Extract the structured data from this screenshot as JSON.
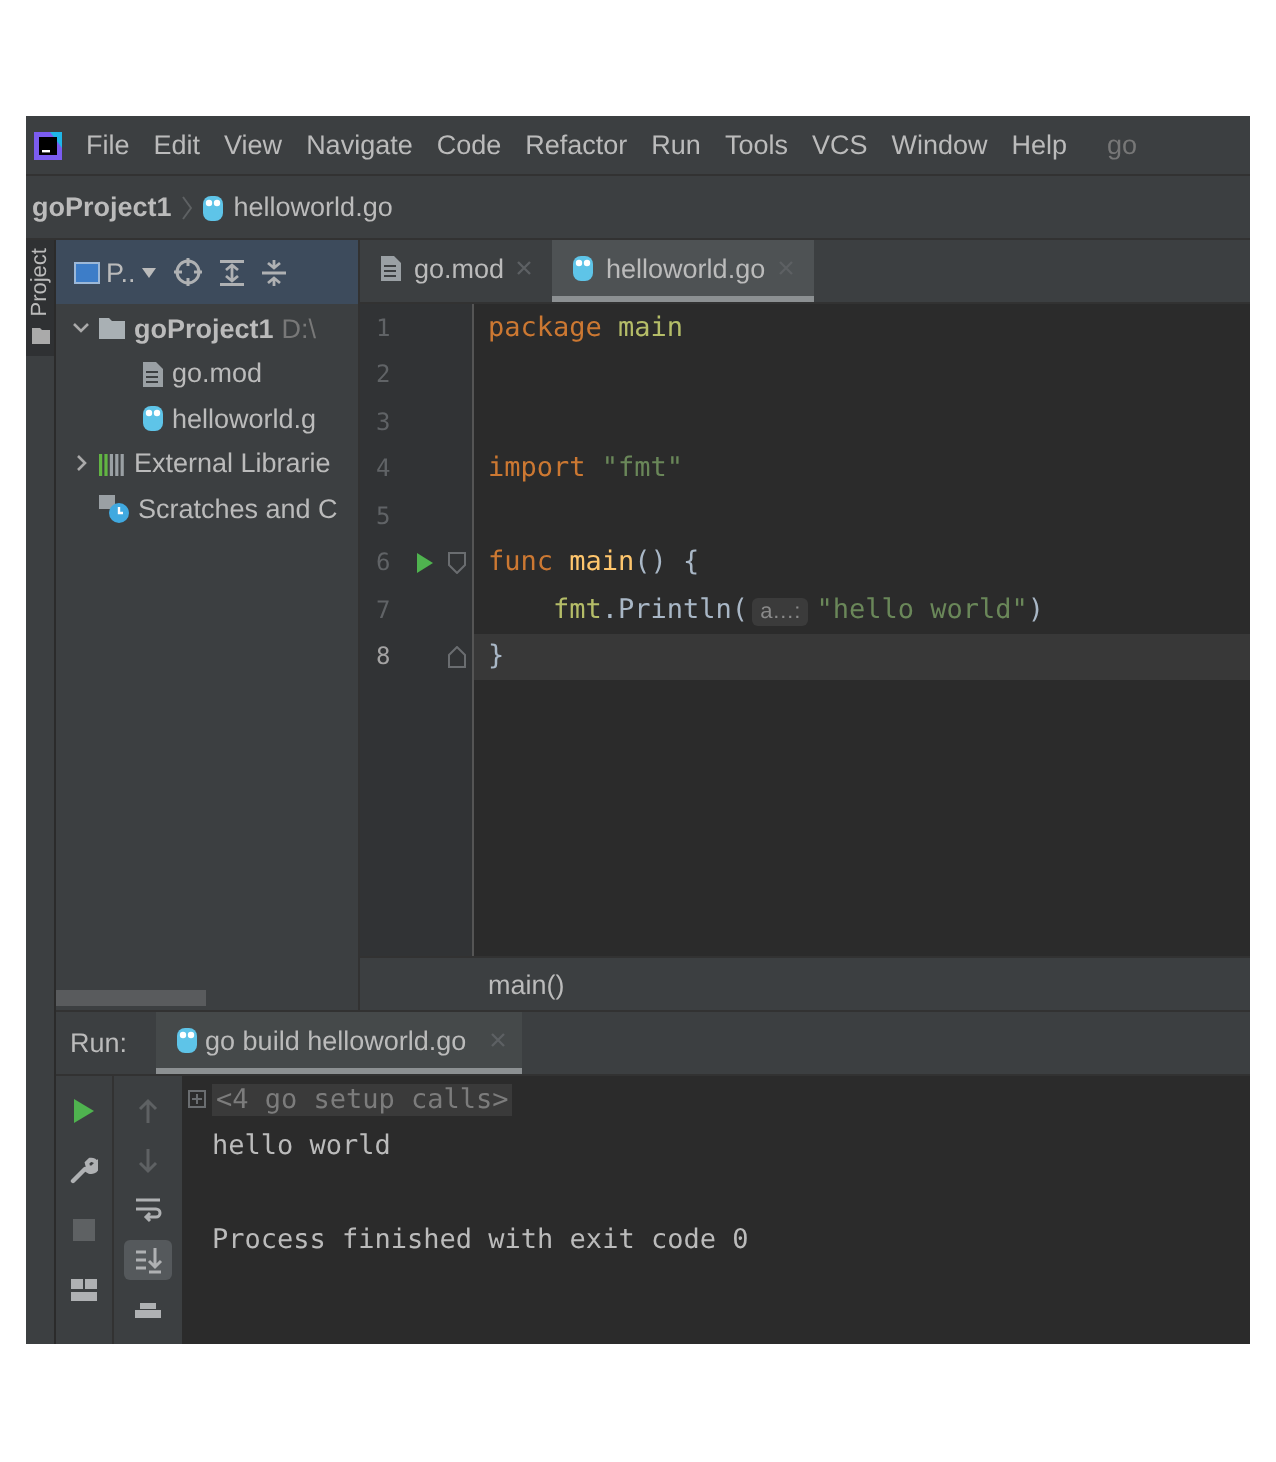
{
  "menu_bar": {
    "items": [
      {
        "label": "File"
      },
      {
        "label": "Edit"
      },
      {
        "label": "View"
      },
      {
        "label": "Navigate"
      },
      {
        "label": "Code"
      },
      {
        "label": "Refactor"
      },
      {
        "label": "Run"
      },
      {
        "label": "Tools"
      },
      {
        "label": "VCS"
      },
      {
        "label": "Window"
      },
      {
        "label": "Help"
      }
    ],
    "project_name": "go"
  },
  "breadcrumb": [
    {
      "label": "goProject1",
      "kind": "project"
    },
    {
      "label": "helloworld.go",
      "kind": "gofile"
    }
  ],
  "tool_stripe": {
    "label": "Project"
  },
  "project_panel": {
    "view_selector": "P..",
    "tree": [
      {
        "label": "goProject1",
        "path": "D:\\",
        "kind": "project",
        "expanded": true,
        "children": [
          {
            "label": "go.mod",
            "kind": "modfile"
          },
          {
            "label": "helloworld.g",
            "kind": "gofile"
          }
        ]
      },
      {
        "label": "External Librarie",
        "kind": "library",
        "expanded": false
      },
      {
        "label": "Scratches and C",
        "kind": "scratch"
      }
    ]
  },
  "editor_tabs": [
    {
      "label": "go.mod",
      "kind": "modfile",
      "selected": false
    },
    {
      "label": "helloworld.go",
      "kind": "gofile",
      "selected": true
    }
  ],
  "code_lines": [
    {
      "number": "1",
      "current": false,
      "runnable": false,
      "fold_start": false,
      "fold_end": false,
      "tokens": [
        {
          "text": "package ",
          "kind": "keyword"
        },
        {
          "text": "main",
          "kind": "package"
        }
      ]
    },
    {
      "number": "2",
      "current": false,
      "runnable": false,
      "fold_start": false,
      "fold_end": false
    },
    {
      "number": "3",
      "current": false,
      "runnable": false,
      "fold_start": false,
      "fold_end": false
    },
    {
      "number": "4",
      "current": false,
      "runnable": false,
      "fold_start": false,
      "fold_end": false,
      "tokens": [
        {
          "text": "import ",
          "kind": "keyword"
        },
        {
          "text": "\"fmt\"",
          "kind": "string"
        }
      ]
    },
    {
      "number": "5",
      "current": false,
      "runnable": false,
      "fold_start": false,
      "fold_end": false
    },
    {
      "number": "6",
      "current": false,
      "runnable": true,
      "fold_start": true,
      "fold_end": false,
      "tokens": [
        {
          "text": "func ",
          "kind": "keyword"
        },
        {
          "text": "main",
          "kind": "function"
        },
        {
          "text": "() {",
          "kind": "plain"
        }
      ]
    },
    {
      "number": "7",
      "current": false,
      "runnable": false,
      "fold_start": false,
      "fold_end": false,
      "tokens": [
        {
          "text": "    fmt",
          "kind": "package"
        },
        {
          "text": ".Println(",
          "kind": "plain"
        },
        {
          "text": "a…:",
          "kind": "hint"
        },
        {
          "text": "\"hello world\"",
          "kind": "string"
        },
        {
          "text": ")",
          "kind": "plain"
        }
      ]
    },
    {
      "number": "8",
      "current": true,
      "runnable": false,
      "fold_start": false,
      "fold_end": true,
      "tokens": [
        {
          "text": "}",
          "kind": "plain"
        }
      ]
    }
  ],
  "editor_breadcrumb": "main()",
  "run_panel": {
    "label": "Run:",
    "tabs": [
      {
        "label": "go build helloworld.go",
        "selected": true
      }
    ],
    "toolbar_left": [
      {
        "kind": "run",
        "disabled": false
      },
      {
        "kind": "wrench",
        "disabled": false
      },
      {
        "kind": "stop",
        "disabled": true
      },
      {
        "kind": "layout",
        "disabled": false
      }
    ],
    "toolbar_right": [
      {
        "kind": "up",
        "disabled": true
      },
      {
        "kind": "down",
        "disabled": true
      },
      {
        "kind": "wrap",
        "disabled": false,
        "on": false
      },
      {
        "kind": "scroll-end",
        "disabled": false,
        "on": true
      },
      {
        "kind": "print",
        "disabled": false
      }
    ],
    "console": [
      {
        "kind": "fold",
        "text": "<4 go setup calls>"
      },
      {
        "kind": "output",
        "text": "hello world"
      },
      {
        "kind": "blank"
      },
      {
        "kind": "output",
        "text": "Process finished with exit code 0"
      }
    ]
  }
}
